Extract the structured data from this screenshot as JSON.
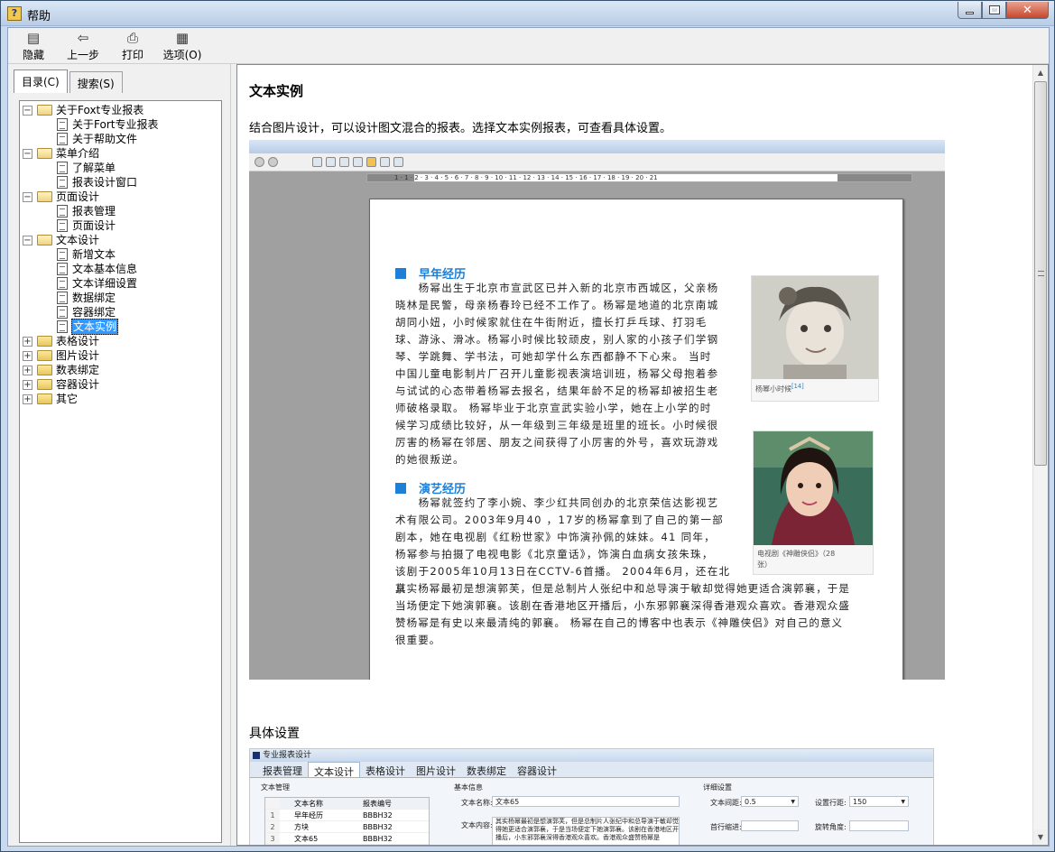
{
  "window": {
    "title": "帮助",
    "app_icon": "help-question-icon"
  },
  "toolbar": {
    "hide": "隐藏",
    "back": "上一步",
    "print": "打印",
    "options": "选项(O)"
  },
  "tabs": {
    "contents": "目录(C)",
    "search": "搜索(S)"
  },
  "tree": {
    "about": "关于Foxt专业报表",
    "about_items": [
      "关于Fort专业报表",
      "关于帮助文件"
    ],
    "menu": "菜单介绍",
    "menu_items": [
      "了解菜单",
      "报表设计窗口"
    ],
    "page": "页面设计",
    "page_items": [
      "报表管理",
      "页面设计"
    ],
    "text": "文本设计",
    "text_items": [
      "新增文本",
      "文本基本信息",
      "文本详细设置",
      "数据绑定",
      "容器绑定",
      "文本实例"
    ],
    "collapsed": [
      "表格设计",
      "图片设计",
      "数表绑定",
      "容器设计",
      "其它"
    ],
    "selected": "文本实例"
  },
  "content": {
    "title": "文本实例",
    "intro": "结合图片设计，可以设计图文混合的报表。选择文本实例报表，可查看具体设置。",
    "settings_heading": "具体设置"
  },
  "preview": {
    "ruler": "1 · 1 · 2 · 3 · 4 · 5 · 6 · 7 · 8 · 9 · 10 · 11 · 12 · 13 · 14 · 15 · 16 · 17 · 18 · 19 · 20 · 21",
    "section1_title": "早年经历",
    "section1_lines": [
      "　　杨幂出生于北京市宣武区已并入新的北京市西城区，父亲杨",
      "晓林是民警，母亲杨春玲已经不工作了。杨幂是地道的北京南城",
      "胡同小妞，小时候家就住在牛街附近，擅长打乒乓球、打羽毛",
      "球、游泳、滑冰。杨幂小时候比较顽皮，别人家的小孩子们学钢",
      "琴、学跳舞、学书法，可她却学什么东西都静不下心来。 当时",
      "中国儿童电影制片厂召开儿童影视表演培训班，杨幂父母抱着参",
      "与试试的心态带着杨幂去报名，结果年龄不足的杨幂却被招生老",
      "师破格录取。 杨幂毕业于北京宣武实验小学，她在上小学的时",
      "候学习成绩比较好，从一年级到三年级是班里的班长。小时候很",
      "厉害的杨幂在邻居、朋友之间获得了小厉害的外号，喜欢玩游戏",
      "的她很叛逆。"
    ],
    "photo1_caption": "杨幂小时候",
    "photo1_ref": "[14]",
    "section2_title": "演艺经历",
    "section2_lines": [
      "　　杨幂就签约了李小婉、李少红共同创办的北京荣信达影视艺",
      "术有限公司。2003年9月40 ，17岁的杨幂拿到了自己的第一部",
      "剧本，她在电视剧《红粉世家》中饰演孙佩的妹妹。41 同年，",
      "杨幂参与拍摄了电视电影《北京童话》，饰演白血病女孩朱珠，",
      "该剧于2005年10月13日在CCTV-6首播。 2004年6月，还在北京"
    ],
    "section2_wide_lines": [
      "其实杨幂最初是想演郭芙，但是总制片人张纪中和总导演于敏却觉得她更适合演郭襄，于是",
      "当场便定下她演郭襄。该剧在香港地区开播后，小东邪郭襄深得香港观众喜欢。香港观众盛",
      "赞杨幂是有史以来最清纯的郭襄。 杨幂在自己的博客中也表示《神雕侠侣》对自己的意义",
      "很重要。"
    ],
    "photo2_caption_line1": "电视剧《神雕侠侣》（28",
    "photo2_caption_line2": "张）"
  },
  "designer": {
    "title": "专业报表设计",
    "tabs": [
      "报表管理",
      "文本设计",
      "表格设计",
      "图片设计",
      "数表绑定",
      "容器设计"
    ],
    "group_text_mgmt": "文本管理",
    "group_basic": "基本信息",
    "group_detail": "详细设置",
    "col_name": "文本名称",
    "col_code": "报表编号",
    "rows": [
      {
        "n": "1",
        "name": "早年经历",
        "code": "BBBH32"
      },
      {
        "n": "2",
        "name": "方块",
        "code": "BBBH32"
      },
      {
        "n": "3",
        "name": "文本65",
        "code": "BBBH32"
      }
    ],
    "text_name_label": "文本名称:",
    "text_name_value": "文本65",
    "text_content_label": "文本内容:",
    "text_content_value": "其实杨幂最初是想演郭芙，但是总制片人张纪中和总导演于敏却觉得她更适合演郭襄，于是当场便定下她演郭襄。该剧在香港地区开播后，小东邪郭襄深得香港观众喜欢。香港观众盛赞杨幂是",
    "line_spacing_label": "文本间距:",
    "line_spacing_value": "0.5",
    "row_spacing_label": "设置行距:",
    "row_spacing_value": "150",
    "first_indent_label": "首行缩进:",
    "rotate_label": "旋转角度:"
  }
}
